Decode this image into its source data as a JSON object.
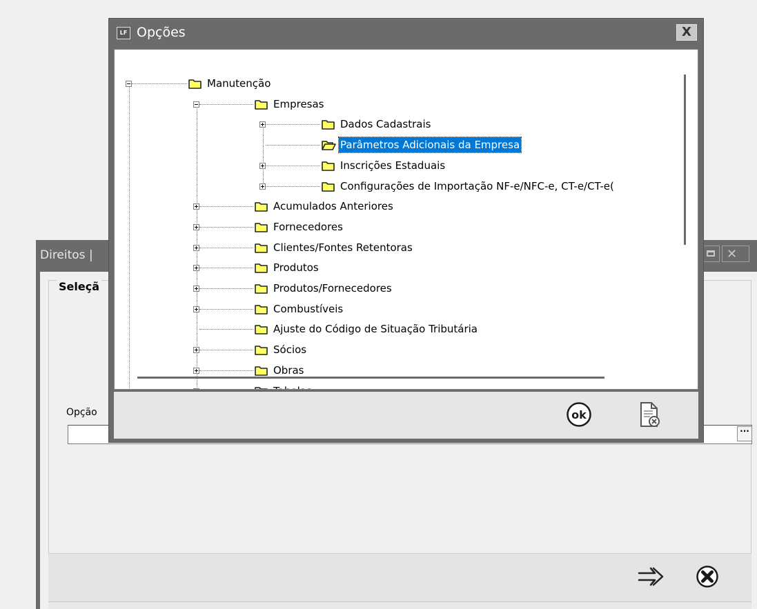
{
  "background_window": {
    "title": "Direitos |",
    "group_label": "Seleçã",
    "option_label": "Opção",
    "option_value": "",
    "ellipsis_label": "···"
  },
  "dialog": {
    "app_icon_text": "LF",
    "title": "Opções",
    "close_label": "X",
    "ok_label": "ok",
    "tree": [
      {
        "label": "Manutenção",
        "level": 0,
        "expander": "minus",
        "state": "closed"
      },
      {
        "label": "Empresas",
        "level": 1,
        "expander": "minus",
        "state": "closed"
      },
      {
        "label": "Dados Cadastrais",
        "level": 2,
        "expander": "plus",
        "state": "closed"
      },
      {
        "label": "Parâmetros Adicionais da Empresa",
        "level": 2,
        "expander": "none",
        "state": "open",
        "selected": true
      },
      {
        "label": "Inscrições Estaduais",
        "level": 2,
        "expander": "plus",
        "state": "closed"
      },
      {
        "label": "Configurações de Importação NF-e/NFC-e, CT-e/CT-e(",
        "level": 2,
        "expander": "plus",
        "state": "closed"
      },
      {
        "label": "Acumulados Anteriores",
        "level": 1,
        "expander": "plus",
        "state": "closed"
      },
      {
        "label": "Fornecedores",
        "level": 1,
        "expander": "plus",
        "state": "closed"
      },
      {
        "label": "Clientes/Fontes Retentoras",
        "level": 1,
        "expander": "plus",
        "state": "closed"
      },
      {
        "label": "Produtos",
        "level": 1,
        "expander": "plus",
        "state": "closed"
      },
      {
        "label": "Produtos/Fornecedores",
        "level": 1,
        "expander": "plus",
        "state": "closed"
      },
      {
        "label": "Combustíveis",
        "level": 1,
        "expander": "plus",
        "state": "closed"
      },
      {
        "label": "Ajuste do Código de Situação Tributária",
        "level": 1,
        "expander": "none",
        "state": "closed"
      },
      {
        "label": "Sócios",
        "level": 1,
        "expander": "plus",
        "state": "closed"
      },
      {
        "label": "Obras",
        "level": 1,
        "expander": "plus",
        "state": "closed"
      },
      {
        "label": "Tabelas",
        "level": 1,
        "expander": "plus",
        "state": "closed"
      }
    ]
  },
  "colors": {
    "selection": "#0078d7",
    "folder_fill": "#ffff66",
    "window_frame": "#6b6b6b"
  },
  "icons": [
    "folder-icon",
    "folder-open-icon",
    "ok-icon",
    "cancel-document-icon",
    "arrow-right-icon",
    "close-circle-icon"
  ]
}
